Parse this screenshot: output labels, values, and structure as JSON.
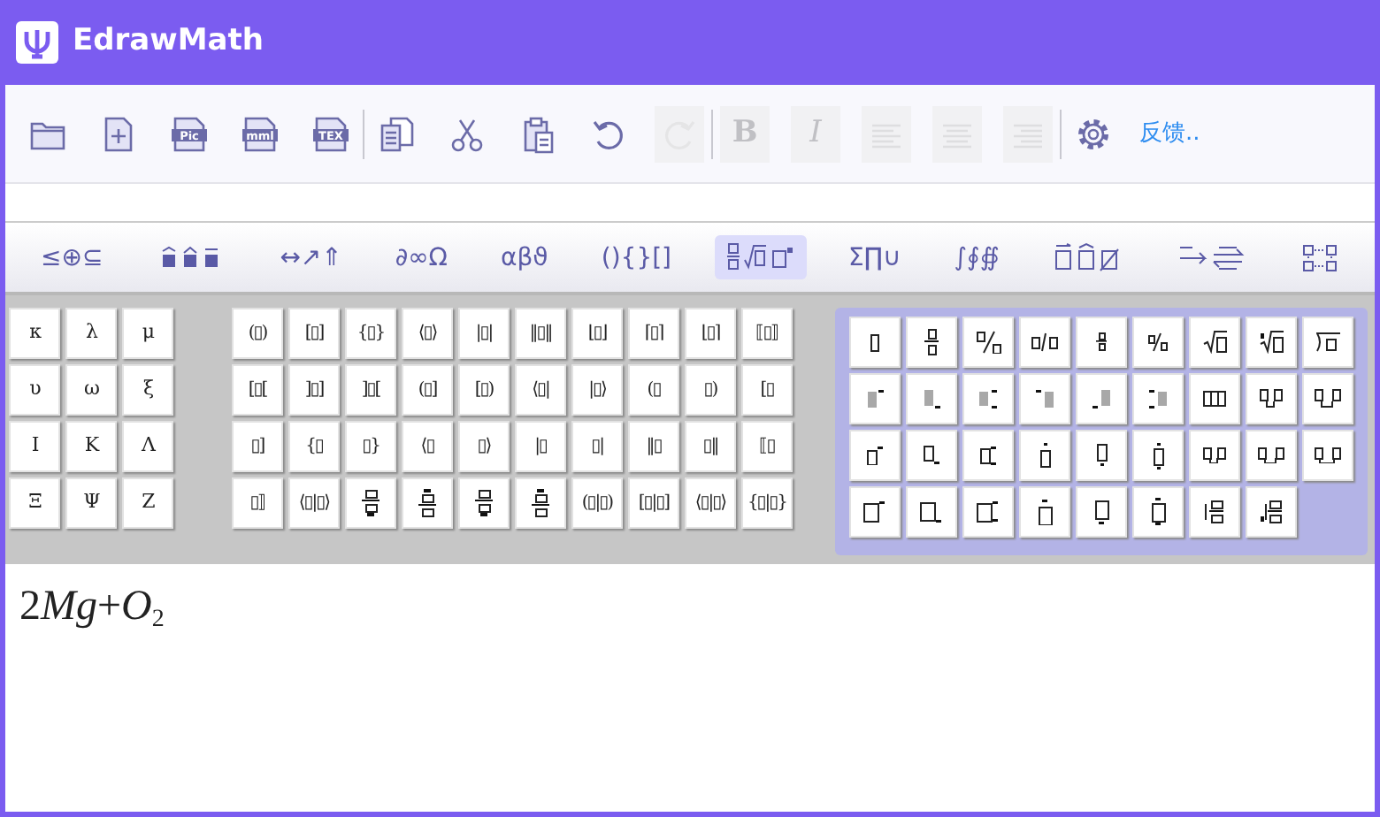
{
  "window": {
    "title": "EdrawMath"
  },
  "toolbar_groups": [
    [
      {
        "kind": "open",
        "disabled": false
      },
      {
        "kind": "new",
        "disabled": false
      },
      {
        "kind": "export",
        "label": "Pic",
        "disabled": false
      },
      {
        "kind": "export",
        "label": "mml",
        "disabled": false
      },
      {
        "kind": "export",
        "label": "TEX",
        "disabled": false
      }
    ],
    [
      {
        "kind": "copy",
        "disabled": false
      },
      {
        "kind": "cut",
        "disabled": false
      },
      {
        "kind": "paste",
        "disabled": false
      },
      {
        "kind": "undo",
        "disabled": false
      },
      {
        "kind": "redo",
        "disabled": true
      }
    ],
    [
      {
        "kind": "bold",
        "label": "B",
        "disabled": true
      },
      {
        "kind": "italic",
        "label": "I",
        "disabled": true
      },
      {
        "kind": "align-left",
        "disabled": true
      },
      {
        "kind": "align-center",
        "disabled": true
      },
      {
        "kind": "align-right",
        "disabled": true
      }
    ],
    [
      {
        "kind": "settings",
        "disabled": false
      },
      {
        "kind": "link",
        "label": "反馈..",
        "disabled": false
      }
    ]
  ],
  "categories": [
    {
      "kind": "text",
      "label": "≤⊕⊆",
      "selected": false
    },
    {
      "kind": "accent-boxes",
      "selected": false
    },
    {
      "kind": "text",
      "label": "↔↗⇑",
      "selected": false
    },
    {
      "kind": "text",
      "label": "∂∞Ω",
      "selected": false
    },
    {
      "kind": "text",
      "label": "αβϑ",
      "selected": false
    },
    {
      "kind": "text",
      "label": "(){}[]",
      "selected": false
    },
    {
      "kind": "templates",
      "selected": true
    },
    {
      "kind": "text",
      "label": "Σ∏∪",
      "selected": false
    },
    {
      "kind": "text",
      "label": "∫∮∯",
      "selected": false
    },
    {
      "kind": "box-accents",
      "selected": false
    },
    {
      "kind": "labeled-arrows",
      "selected": false
    },
    {
      "kind": "matrix",
      "selected": false
    }
  ],
  "greek_palette": [
    "κ",
    "λ",
    "μ",
    "υ",
    "ω",
    "ξ",
    "Ι",
    "Κ",
    "Λ",
    "Ξ",
    "Ψ",
    "Ζ"
  ],
  "fence_palette": [
    {
      "kind": "glyph",
      "text": "(▯)"
    },
    {
      "kind": "glyph",
      "text": "[▯]"
    },
    {
      "kind": "glyph",
      "text": "{▯}"
    },
    {
      "kind": "glyph",
      "text": "⟨▯⟩"
    },
    {
      "kind": "glyph",
      "text": "|▯|"
    },
    {
      "kind": "glyph",
      "text": "‖▯‖"
    },
    {
      "kind": "glyph",
      "text": "⌊▯⌋"
    },
    {
      "kind": "glyph",
      "text": "⌈▯⌉"
    },
    {
      "kind": "glyph",
      "text": "⌊▯⌉"
    },
    {
      "kind": "glyph",
      "text": "⟦▯⟧"
    },
    {
      "kind": "glyph",
      "text": "[▯["
    },
    {
      "kind": "glyph",
      "text": "]▯]"
    },
    {
      "kind": "glyph",
      "text": "]▯["
    },
    {
      "kind": "glyph",
      "text": "(▯]"
    },
    {
      "kind": "glyph",
      "text": "[▯)"
    },
    {
      "kind": "glyph",
      "text": "⟨▯|"
    },
    {
      "kind": "glyph",
      "text": "|▯⟩"
    },
    {
      "kind": "glyph",
      "text": "(▯"
    },
    {
      "kind": "glyph",
      "text": "▯)"
    },
    {
      "kind": "glyph",
      "text": "[▯"
    },
    {
      "kind": "glyph",
      "text": "▯]"
    },
    {
      "kind": "glyph",
      "text": "{▯"
    },
    {
      "kind": "glyph",
      "text": "▯}"
    },
    {
      "kind": "glyph",
      "text": "⟨▯"
    },
    {
      "kind": "glyph",
      "text": "▯⟩"
    },
    {
      "kind": "glyph",
      "text": "|▯"
    },
    {
      "kind": "glyph",
      "text": "▯|"
    },
    {
      "kind": "glyph",
      "text": "‖▯"
    },
    {
      "kind": "glyph",
      "text": "▯‖"
    },
    {
      "kind": "glyph",
      "text": "⟦▯"
    },
    {
      "kind": "glyph",
      "text": "▯⟧"
    },
    {
      "kind": "glyph",
      "text": "⟨▯|▯⟩"
    },
    {
      "kind": "stack-under"
    },
    {
      "kind": "stack-over"
    },
    {
      "kind": "stack-under"
    },
    {
      "kind": "stack-over"
    },
    {
      "kind": "glyph",
      "text": "(▯|▯)"
    },
    {
      "kind": "glyph",
      "text": "[▯|▯]"
    },
    {
      "kind": "glyph",
      "text": "⟨▯|▯⟩"
    },
    {
      "kind": "glyph",
      "text": "{▯|▯}"
    }
  ],
  "template_palette": [
    {
      "kind": "box"
    },
    {
      "kind": "frac"
    },
    {
      "kind": "slash-frac"
    },
    {
      "kind": "inline-frac"
    },
    {
      "kind": "small-frac"
    },
    {
      "kind": "small-slash"
    },
    {
      "kind": "sqrt"
    },
    {
      "kind": "nthroot"
    },
    {
      "kind": "longdiv"
    },
    {
      "kind": "sup-shaded"
    },
    {
      "kind": "sub-shaded"
    },
    {
      "kind": "subsup-shaded"
    },
    {
      "kind": "presup-shaded"
    },
    {
      "kind": "presub-shaded"
    },
    {
      "kind": "presubsup-shaded"
    },
    {
      "kind": "columns"
    },
    {
      "kind": "pair-over"
    },
    {
      "kind": "pair-over-wide"
    },
    {
      "kind": "sup-small"
    },
    {
      "kind": "sub-small"
    },
    {
      "kind": "subsup-small"
    },
    {
      "kind": "over-small"
    },
    {
      "kind": "under-small"
    },
    {
      "kind": "overunder-small"
    },
    {
      "kind": "pair-under"
    },
    {
      "kind": "pair-under-wide"
    },
    {
      "kind": "pair-under-long"
    },
    {
      "kind": "sup-large"
    },
    {
      "kind": "sub-large"
    },
    {
      "kind": "subsup-large"
    },
    {
      "kind": "over-large"
    },
    {
      "kind": "under-large"
    },
    {
      "kind": "overunder-large"
    },
    {
      "kind": "stack-pre"
    },
    {
      "kind": "stack-pre-sub"
    }
  ],
  "editor": {
    "tokens": [
      {
        "text": "2",
        "kind": "number"
      },
      {
        "text": "Mg",
        "kind": "variable"
      },
      {
        "text": "+",
        "kind": "operator"
      },
      {
        "text": "O",
        "kind": "variable"
      },
      {
        "text": "2",
        "kind": "subscript"
      }
    ]
  }
}
